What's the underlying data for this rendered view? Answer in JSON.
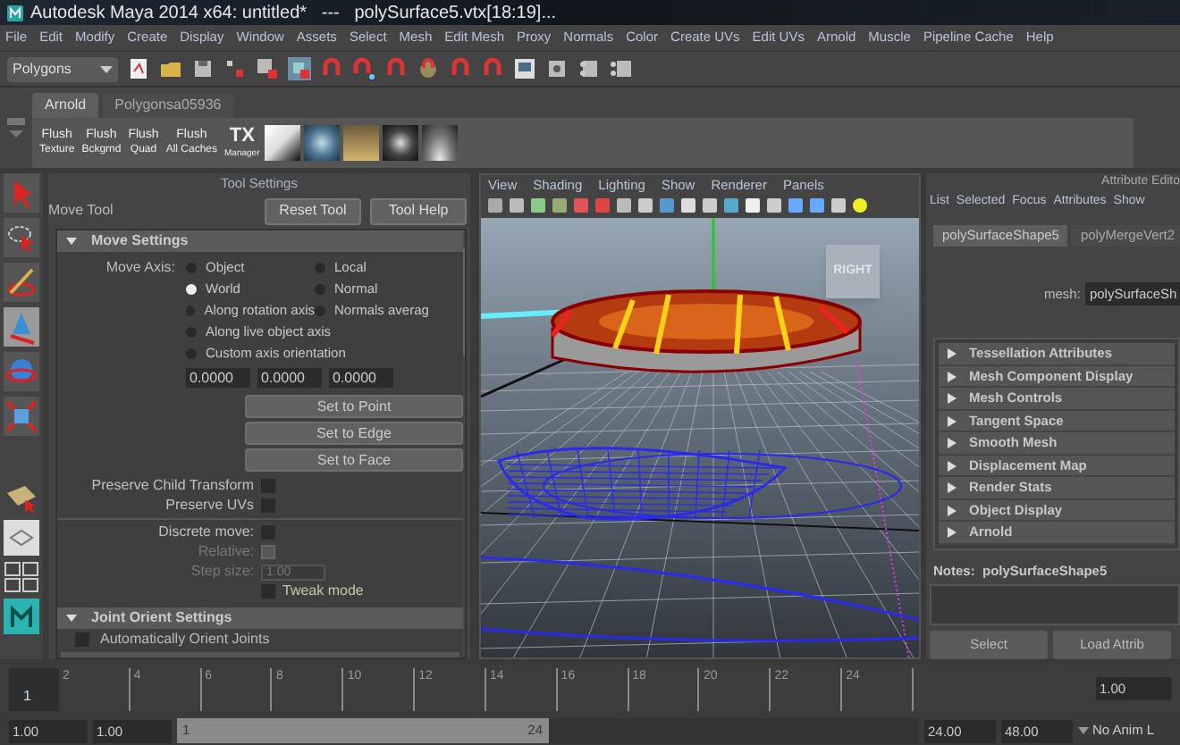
{
  "window": {
    "title": "Autodesk Maya 2014 x64: untitled*   ---   polySurface5.vtx[18:19]..."
  },
  "menu_bar": [
    "File",
    "Edit",
    "Modify",
    "Create",
    "Display",
    "Window",
    "Assets",
    "Select",
    "Mesh",
    "Edit Mesh",
    "Proxy",
    "Normals",
    "Color",
    "Create UVs",
    "Edit UVs",
    "Arnold",
    "Muscle",
    "Pipeline Cache",
    "Help"
  ],
  "toolbar": {
    "mode_dropdown": "Polygons"
  },
  "shelf": {
    "tabs": [
      {
        "label": "Arnold",
        "selected": true
      },
      {
        "label": "Polygonsa05936",
        "selected": false
      }
    ],
    "buttons": [
      {
        "kind": "text",
        "top": "Flush",
        "bottom": "Texture"
      },
      {
        "kind": "text",
        "top": "Flush",
        "bottom": "Bckgrnd"
      },
      {
        "kind": "text",
        "top": "Flush",
        "bottom": "Quad"
      },
      {
        "kind": "text",
        "top": "Flush",
        "bottom": "All Caches"
      },
      {
        "kind": "logo",
        "top": "TX",
        "bottom": "Manager"
      },
      {
        "kind": "preview"
      },
      {
        "kind": "preview"
      },
      {
        "kind": "preview"
      },
      {
        "kind": "preview"
      },
      {
        "kind": "preview"
      }
    ]
  },
  "tool_settings": {
    "header": "Tool Settings",
    "tool_name": "Move Tool",
    "buttons": [
      "Reset Tool",
      "Tool Help"
    ],
    "move_settings": {
      "title": "Move Settings",
      "expanded": true,
      "axis_label": "Move Axis:",
      "axis_options": [
        {
          "label": "Object",
          "selected": false
        },
        {
          "label": "Local",
          "selected": false
        },
        {
          "label": "World",
          "selected": true
        },
        {
          "label": "Normal",
          "selected": false
        },
        {
          "label": "Along rotation axis",
          "selected": false
        },
        {
          "label": "Normals averag",
          "selected": false
        },
        {
          "label": "Along live object axis",
          "selected": false
        },
        {
          "label": "Custom axis orientation",
          "selected": false
        }
      ],
      "axis_values": [
        "0.0000",
        "0.0000",
        "0.0000"
      ],
      "set_buttons": [
        "Set to Point",
        "Set to Edge",
        "Set to Face"
      ],
      "transform_options": [
        {
          "kind": "checkbox",
          "label": "Preserve Child Transform",
          "checked": false,
          "disabled": false
        },
        {
          "kind": "checkbox",
          "label": "Preserve UVs",
          "checked": false,
          "disabled": false
        }
      ],
      "move_options": [
        {
          "kind": "checkbox",
          "label": "Discrete move:",
          "checked": false,
          "disabled": false
        },
        {
          "kind": "checkbox",
          "label": "Relative:",
          "checked": false,
          "disabled": true
        },
        {
          "kind": "field",
          "label": "Step size:",
          "value": "1.00",
          "disabled": true
        },
        {
          "kind": "trailing",
          "label": "Tweak mode",
          "checked": false,
          "disabled": false
        }
      ]
    },
    "joint_orient": {
      "title": "Joint Orient Settings",
      "expanded": true,
      "options": [
        {
          "label": "Automatically Orient Joints",
          "checked": false
        }
      ]
    }
  },
  "viewport": {
    "menu": [
      "View",
      "Shading",
      "Lighting",
      "Show",
      "Renderer",
      "Panels"
    ],
    "view_cube": "RIGHT"
  },
  "attribute_editor": {
    "header": "Attribute Edito",
    "menu": [
      "List",
      "Selected",
      "Focus",
      "Attributes",
      "Show"
    ],
    "tabs": [
      {
        "label": "polySurfaceShape5",
        "selected": true
      },
      {
        "label": "polyMergeVert2",
        "selected": false
      }
    ],
    "mesh_label": "mesh:",
    "mesh_value": "polySurfaceSh",
    "sections": [
      {
        "title": "Tessellation Attributes",
        "expanded": false
      },
      {
        "title": "Mesh Component Display",
        "expanded": false
      },
      {
        "title": "Mesh Controls",
        "expanded": false
      },
      {
        "title": "Tangent Space",
        "expanded": false
      },
      {
        "title": "Smooth Mesh",
        "expanded": false
      },
      {
        "title": "Displacement Map",
        "expanded": false
      },
      {
        "title": "Render Stats",
        "expanded": false
      },
      {
        "title": "Object Display",
        "expanded": false
      },
      {
        "title": "Arnold",
        "expanded": false
      }
    ],
    "notes_label": "Notes:  polySurfaceShape5",
    "buttons": [
      "Select",
      "Load Attrib"
    ]
  },
  "timeline": {
    "current_frame": "1",
    "ticks": [
      "2",
      "4",
      "6",
      "8",
      "10",
      "12",
      "14",
      "16",
      "18",
      "20",
      "22",
      "24"
    ],
    "current_time": "1.00"
  },
  "range_slider": {
    "level": 0.5,
    "start": "1.00",
    "playback_start": "1.00",
    "slider_start": "1",
    "slider_end": "24",
    "playback_end": "24.00",
    "end": "48.00",
    "anim_layer": "No Anim L"
  }
}
